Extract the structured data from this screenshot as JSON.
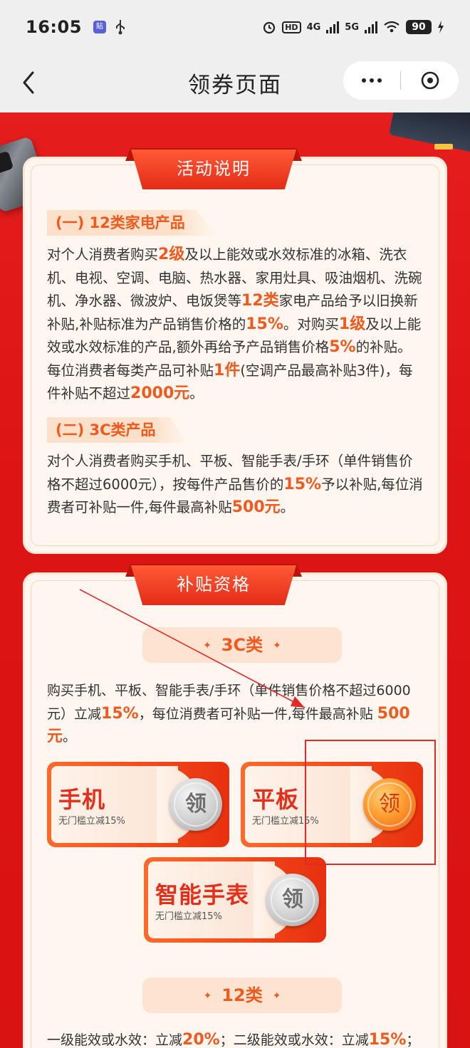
{
  "status_bar": {
    "time": "16:05",
    "app_badge": "贴",
    "hd": "HD",
    "net_4g": "4G",
    "net_5g": "5G",
    "battery": "90"
  },
  "nav": {
    "title": "领券页面"
  },
  "activity": {
    "ribbon": "活动说明",
    "section1_label": "(一) 12类家电产品",
    "section1_text": [
      {
        "t": "对个人消费者购买"
      },
      {
        "t": "2级",
        "hl": true
      },
      {
        "t": "及以上能效或水效标准的冰箱、洗衣机、电视、空调、电脑、热水器、家用灶具、吸油烟机、洗碗机、净水器、微波炉、电饭煲等"
      },
      {
        "t": "12类",
        "hl": true
      },
      {
        "t": "家电产品给予以旧换新补贴,补贴标准为产品销售价格的"
      },
      {
        "t": "15%",
        "hl": true
      },
      {
        "t": "。对购买"
      },
      {
        "t": "1级",
        "hl": true
      },
      {
        "t": "及以上能效或水效标准的产品,额外再给予产品销售价格"
      },
      {
        "t": "5%",
        "hl": true
      },
      {
        "t": "的补贴。每位消费者每类产品可补贴"
      },
      {
        "t": "1件",
        "hl": true
      },
      {
        "t": "(空调产品最高补贴3件)，每件补贴不超过"
      },
      {
        "t": "2000元",
        "hl": true
      },
      {
        "t": "。"
      }
    ],
    "section2_label": "(二) 3C类产品",
    "section2_text": [
      {
        "t": "对个人消费者购买手机、平板、智能手表/手环（单件销售价格不超过6000元），按每件产品售价的"
      },
      {
        "t": "15%",
        "hl": true
      },
      {
        "t": "予以补贴,每位消费者可补贴一件,每件最高补贴"
      },
      {
        "t": "500元",
        "hl": true
      },
      {
        "t": "。"
      }
    ]
  },
  "eligibility": {
    "ribbon": "补贴资格",
    "pill_3c": "3C类",
    "pill_spark": "✦",
    "text_3c": [
      {
        "t": "购买手机、平板、智能手表/手环（单件销售价格不超过6000元）立减"
      },
      {
        "t": "15%",
        "hl": true
      },
      {
        "t": "，每位消费者可补贴一件,每件最高补贴 "
      },
      {
        "t": "500元",
        "hl": true
      },
      {
        "t": "。"
      }
    ],
    "coupons": [
      {
        "name": "手机",
        "desc": "无门槛立减15%",
        "btn": "领"
      },
      {
        "name": "平板",
        "desc": "无门槛立减15%",
        "btn": "领"
      },
      {
        "name": "智能手表",
        "desc": "无门槛立减15%",
        "btn": "领"
      }
    ],
    "pill_12": "12类",
    "text_12": [
      {
        "t": "一级能效或水效：立减"
      },
      {
        "t": "20%",
        "hl": true
      },
      {
        "t": "；二级能效或水效：立减"
      },
      {
        "t": "15%",
        "hl": true
      },
      {
        "t": "；"
      }
    ]
  },
  "colors": {
    "accent": "#f05a1f",
    "background_red": "#dd1414",
    "annotation": "#e12b2b"
  }
}
